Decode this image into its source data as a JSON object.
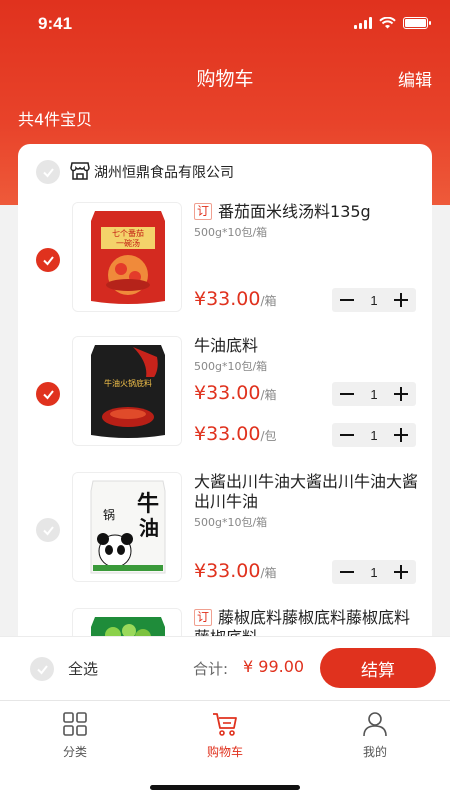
{
  "status": {
    "time": "9:41"
  },
  "nav": {
    "title": "购物车",
    "edit": "编辑"
  },
  "cart": {
    "count_label": "共4件宝贝"
  },
  "store": {
    "name": "湖州恒鼎食品有限公司"
  },
  "items": [
    {
      "tag": "订",
      "title": "番茄面米线汤料135g",
      "spec": "500g*10包/箱",
      "checked": true,
      "prices": [
        {
          "price": "¥33.00",
          "unit": "/箱",
          "qty": "1"
        }
      ]
    },
    {
      "tag": "",
      "title": "牛油底料",
      "spec": "500g*10包/箱",
      "checked": true,
      "prices": [
        {
          "price": "¥33.00",
          "unit": "/箱",
          "qty": "1"
        },
        {
          "price": "¥33.00",
          "unit": "/包",
          "qty": "1"
        }
      ]
    },
    {
      "tag": "",
      "title": "大酱出川牛油大酱出川牛油大酱出川牛油",
      "spec": "500g*10包/箱",
      "checked": false,
      "prices": [
        {
          "price": "¥33.00",
          "unit": "/箱",
          "qty": "1"
        }
      ]
    },
    {
      "tag": "订",
      "title": "藤椒底料藤椒底料藤椒底料藤椒底料",
      "spec": "",
      "checked": false,
      "prices": []
    }
  ],
  "product_art": {
    "item1": [
      "七个番茄",
      "一碗汤"
    ],
    "item2": [
      "牛油火锅底料"
    ],
    "item3": [
      "牛",
      "油",
      "锅"
    ]
  },
  "footer": {
    "select_all": "全选",
    "total_label": "合计:",
    "total_amount": "¥ 99.00",
    "checkout": "结算"
  },
  "tabs": [
    {
      "label": "分类",
      "icon": "grid-icon",
      "active": false
    },
    {
      "label": "购物车",
      "icon": "cart-icon",
      "active": true
    },
    {
      "label": "我的",
      "icon": "user-icon",
      "active": false
    }
  ],
  "colors": {
    "accent": "#e0321e",
    "background": "#f2f2f2"
  }
}
